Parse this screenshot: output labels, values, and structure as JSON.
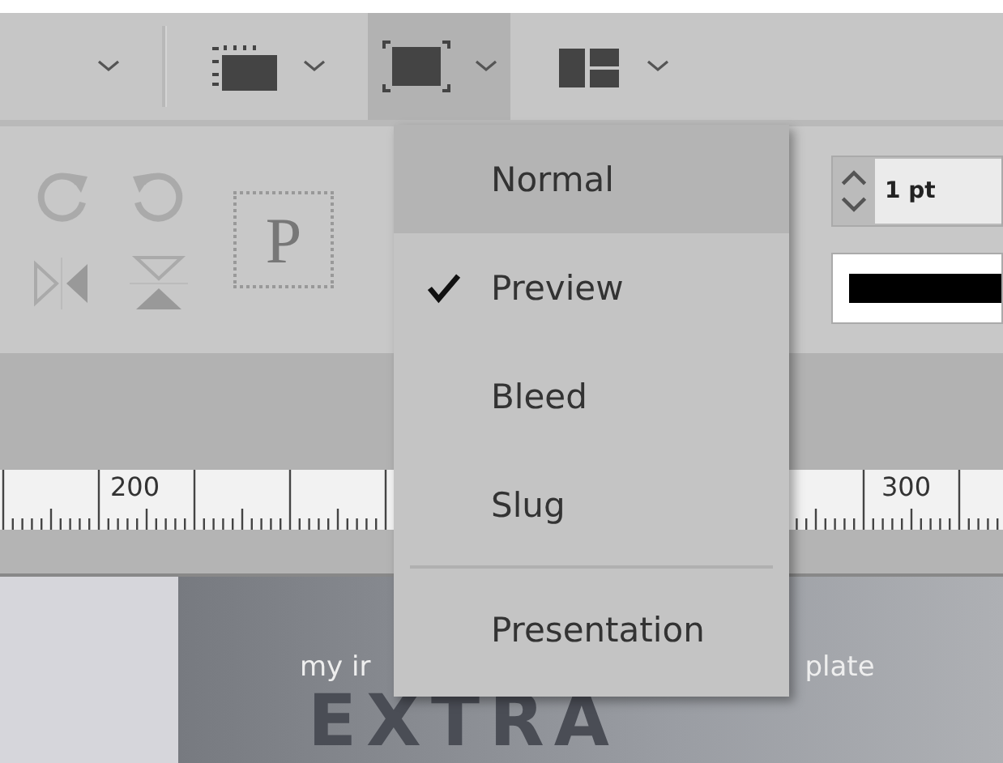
{
  "toolbar": {
    "screen_mode_button": {
      "selected": true
    }
  },
  "transform_panel": {
    "proxy_letter": "P"
  },
  "stroke": {
    "weight": "1 pt"
  },
  "ruler": {
    "labels": [
      "200",
      "300"
    ]
  },
  "document": {
    "subtitle_left": "my ir",
    "subtitle_right": "plate",
    "headline": "EXTRA"
  },
  "screen_mode_menu": {
    "items": [
      {
        "kind": "item",
        "label": "Normal",
        "checked": false,
        "selected": true
      },
      {
        "kind": "item",
        "label": "Preview",
        "checked": true,
        "selected": false
      },
      {
        "kind": "item",
        "label": "Bleed",
        "checked": false,
        "selected": false
      },
      {
        "kind": "item",
        "label": "Slug",
        "checked": false,
        "selected": false
      },
      {
        "kind": "separator"
      },
      {
        "kind": "item",
        "label": "Presentation",
        "checked": false,
        "selected": false
      }
    ]
  }
}
